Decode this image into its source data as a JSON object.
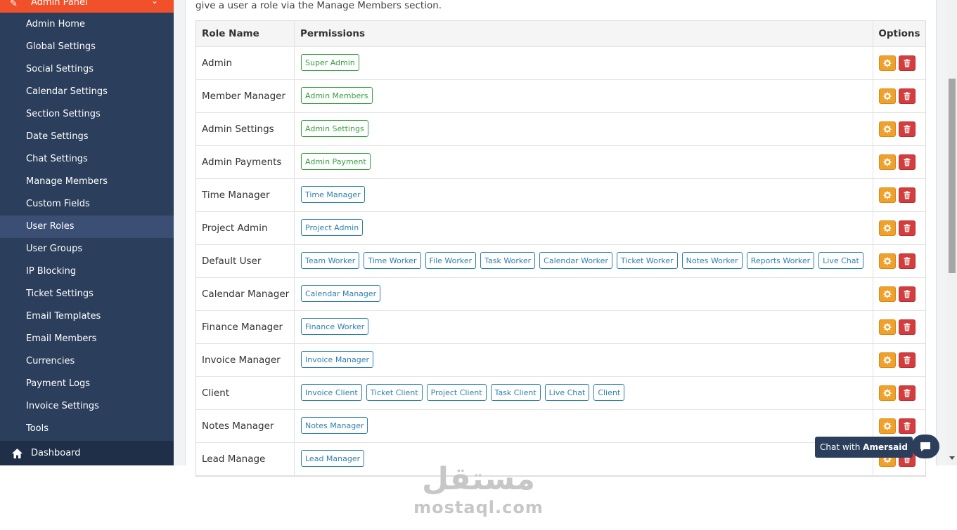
{
  "sidebar": {
    "top_item": "Admin Panel",
    "items": [
      {
        "label": "Admin Home"
      },
      {
        "label": "Global Settings"
      },
      {
        "label": "Social Settings"
      },
      {
        "label": "Calendar Settings"
      },
      {
        "label": "Section Settings"
      },
      {
        "label": "Date Settings"
      },
      {
        "label": "Chat Settings"
      },
      {
        "label": "Manage Members"
      },
      {
        "label": "Custom Fields"
      },
      {
        "label": "User Roles",
        "active": true
      },
      {
        "label": "User Groups"
      },
      {
        "label": "IP Blocking"
      },
      {
        "label": "Ticket Settings"
      },
      {
        "label": "Email Templates"
      },
      {
        "label": "Email Members"
      },
      {
        "label": "Currencies"
      },
      {
        "label": "Payment Logs"
      },
      {
        "label": "Invoice Settings"
      },
      {
        "label": "Tools"
      }
    ],
    "dashboard_label": "Dashboard"
  },
  "main": {
    "intro_text": "give a user a role via the Manage Members section.",
    "table": {
      "headers": {
        "role": "Role Name",
        "permissions": "Permissions",
        "options": "Options"
      },
      "rows": [
        {
          "role": "Admin",
          "permissions": [
            {
              "label": "Super Admin",
              "color": "green"
            }
          ]
        },
        {
          "role": "Member Manager",
          "permissions": [
            {
              "label": "Admin Members",
              "color": "green"
            }
          ]
        },
        {
          "role": "Admin Settings",
          "permissions": [
            {
              "label": "Admin Settings",
              "color": "green"
            }
          ]
        },
        {
          "role": "Admin Payments",
          "permissions": [
            {
              "label": "Admin Payment",
              "color": "green"
            }
          ]
        },
        {
          "role": "Time Manager",
          "permissions": [
            {
              "label": "Time Manager",
              "color": "blue"
            }
          ]
        },
        {
          "role": "Project Admin",
          "permissions": [
            {
              "label": "Project Admin",
              "color": "blue"
            }
          ]
        },
        {
          "role": "Default User",
          "permissions": [
            {
              "label": "Team Worker",
              "color": "blue"
            },
            {
              "label": "Time Worker",
              "color": "blue"
            },
            {
              "label": "File Worker",
              "color": "blue"
            },
            {
              "label": "Task Worker",
              "color": "blue"
            },
            {
              "label": "Calendar Worker",
              "color": "blue"
            },
            {
              "label": "Ticket Worker",
              "color": "blue"
            },
            {
              "label": "Notes Worker",
              "color": "blue"
            },
            {
              "label": "Reports Worker",
              "color": "blue"
            },
            {
              "label": "Live Chat",
              "color": "blue"
            }
          ]
        },
        {
          "role": "Calendar Manager",
          "permissions": [
            {
              "label": "Calendar Manager",
              "color": "blue"
            }
          ]
        },
        {
          "role": "Finance Manager",
          "permissions": [
            {
              "label": "Finance Worker",
              "color": "blue"
            }
          ]
        },
        {
          "role": "Invoice Manager",
          "permissions": [
            {
              "label": "Invoice Manager",
              "color": "blue"
            }
          ]
        },
        {
          "role": "Client",
          "permissions": [
            {
              "label": "Invoice Client",
              "color": "blue"
            },
            {
              "label": "Ticket Client",
              "color": "blue"
            },
            {
              "label": "Project Client",
              "color": "blue"
            },
            {
              "label": "Task Client",
              "color": "blue"
            },
            {
              "label": "Live Chat",
              "color": "blue"
            },
            {
              "label": "Client",
              "color": "blue"
            }
          ]
        },
        {
          "role": "Notes Manager",
          "permissions": [
            {
              "label": "Notes Manager",
              "color": "blue"
            }
          ]
        },
        {
          "role": "Lead Manage",
          "permissions": [
            {
              "label": "Lead Manager",
              "color": "blue"
            }
          ]
        }
      ]
    }
  },
  "chat_widget": {
    "prefix": "Chat with",
    "name": "Amersaid"
  },
  "watermark": {
    "arabic": "مستقل",
    "latin": "mostaql.com"
  },
  "colors": {
    "sidebar_bg": "#2b3e5b",
    "sidebar_active": "#3b4f74",
    "sidebar_top_accent": "#f0512b",
    "tag_green": "#33a03c",
    "tag_blue": "#2e7fb0",
    "gear_button": "#f0a12c",
    "delete_button": "#d43d3d"
  },
  "icons": {
    "sidebar_top": "wrench-icon",
    "dashboard": "home-icon",
    "edit_button": "gear-icon",
    "delete_button": "trash-icon",
    "chat_button": "chat-bubble-icon"
  }
}
